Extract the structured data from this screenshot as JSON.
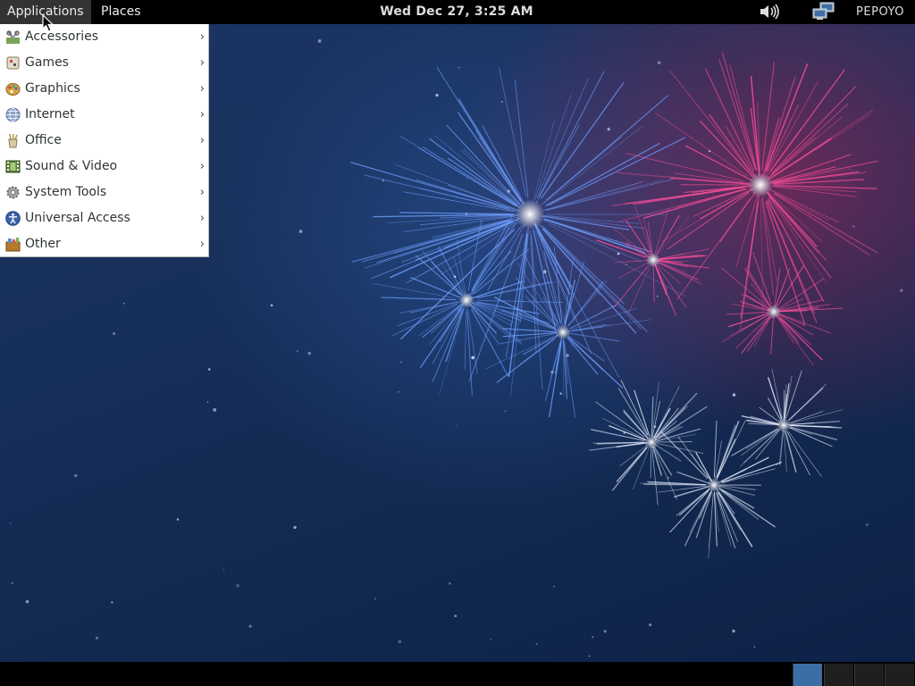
{
  "top_panel": {
    "applications_label": "Applications",
    "places_label": "Places",
    "clock": "Wed Dec 27,  3:25 AM",
    "user": "PEPOYO",
    "icons": [
      "volume-icon",
      "network-icon"
    ]
  },
  "applications_menu": {
    "items": [
      {
        "label": "Accessories",
        "icon": "accessories-icon"
      },
      {
        "label": "Games",
        "icon": "games-icon"
      },
      {
        "label": "Graphics",
        "icon": "graphics-icon"
      },
      {
        "label": "Internet",
        "icon": "internet-icon"
      },
      {
        "label": "Office",
        "icon": "office-icon"
      },
      {
        "label": "Sound & Video",
        "icon": "sound-video-icon"
      },
      {
        "label": "System Tools",
        "icon": "system-tools-icon"
      },
      {
        "label": "Universal Access",
        "icon": "universal-access-icon"
      },
      {
        "label": "Other",
        "icon": "other-icon"
      }
    ],
    "submenu_arrow": "›"
  },
  "bottom_panel": {
    "workspaces": [
      {
        "active": true
      },
      {
        "active": false
      },
      {
        "active": false
      },
      {
        "active": false
      }
    ]
  },
  "colors": {
    "panel": "#000000",
    "menu_bg": "#ffffff",
    "active_workspace": "#3d6da5",
    "firework_blue": "#6fa0ff",
    "firework_pink": "#ff4f9a",
    "firework_white": "#e8eeff"
  }
}
